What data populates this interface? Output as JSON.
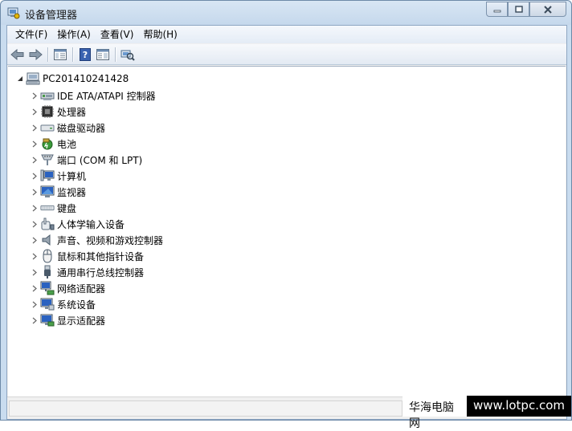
{
  "window": {
    "title": "设备管理器",
    "caption": {
      "minimize": "minimize",
      "maximize": "maximize",
      "close": "close"
    }
  },
  "menubar": [
    {
      "label": "文件(F)"
    },
    {
      "label": "操作(A)"
    },
    {
      "label": "查看(V)"
    },
    {
      "label": "帮助(H)"
    }
  ],
  "toolbar": {
    "buttons": [
      "back-arrow-icon",
      "forward-arrow-icon",
      "properties-pane-icon",
      "help-icon",
      "show-hide-pane-icon",
      "scan-hardware-icon"
    ]
  },
  "tree": {
    "root": {
      "label": "PC201410241428",
      "icon": "computer-icon",
      "expanded": true
    },
    "children": [
      {
        "label": "IDE ATA/ATAPI 控制器",
        "icon": "ide-controller-icon"
      },
      {
        "label": "处理器",
        "icon": "processor-icon"
      },
      {
        "label": "磁盘驱动器",
        "icon": "disk-drive-icon"
      },
      {
        "label": "电池",
        "icon": "battery-icon"
      },
      {
        "label": "端口 (COM 和 LPT)",
        "icon": "port-icon"
      },
      {
        "label": "计算机",
        "icon": "computer-monitor-icon"
      },
      {
        "label": "监视器",
        "icon": "monitor-icon"
      },
      {
        "label": "键盘",
        "icon": "keyboard-icon"
      },
      {
        "label": "人体学输入设备",
        "icon": "hid-icon"
      },
      {
        "label": "声音、视频和游戏控制器",
        "icon": "speaker-icon"
      },
      {
        "label": "鼠标和其他指针设备",
        "icon": "mouse-icon"
      },
      {
        "label": "通用串行总线控制器",
        "icon": "usb-icon"
      },
      {
        "label": "网络适配器",
        "icon": "network-adapter-icon"
      },
      {
        "label": "系统设备",
        "icon": "system-devices-icon"
      },
      {
        "label": "显示适配器",
        "icon": "display-adapter-icon"
      }
    ]
  },
  "watermark": {
    "site_name": "华海电脑网",
    "url": "www.lotpc.com"
  },
  "colors": {
    "frame": "#c9dcef",
    "watermark_bg": "#000000",
    "watermark_text": "#ffffff"
  }
}
